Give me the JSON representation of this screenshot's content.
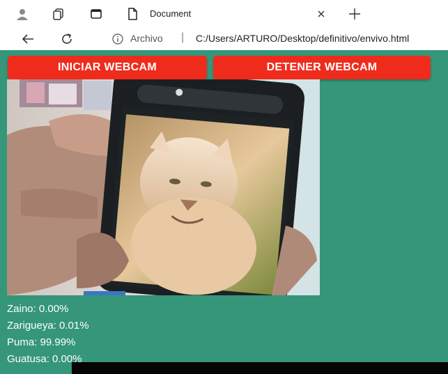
{
  "browser": {
    "tab_title": "Document",
    "address_label": "Archivo",
    "address_separator": "|",
    "url": "C:/Users/ARTURO/Desktop/definitivo/envivo.html",
    "icons": [
      "profile-icon",
      "workspaces-icon",
      "tab-actions-icon",
      "document-icon",
      "close-icon",
      "plus-icon",
      "back-icon",
      "refresh-icon",
      "info-icon"
    ]
  },
  "toolbar": {
    "start_label": "INICIAR WEBCAM",
    "stop_label": "DETENER WEBCAM"
  },
  "predictions": [
    {
      "label": "Zaino: 0.00%"
    },
    {
      "label": "Zarigueya: 0.01%"
    },
    {
      "label": "Puma: 99.99%"
    },
    {
      "label": "Guatusa: 0.00%"
    }
  ],
  "colors": {
    "page_background": "#35967a",
    "button": "#ef2c1c",
    "button_text": "#ffffff"
  }
}
